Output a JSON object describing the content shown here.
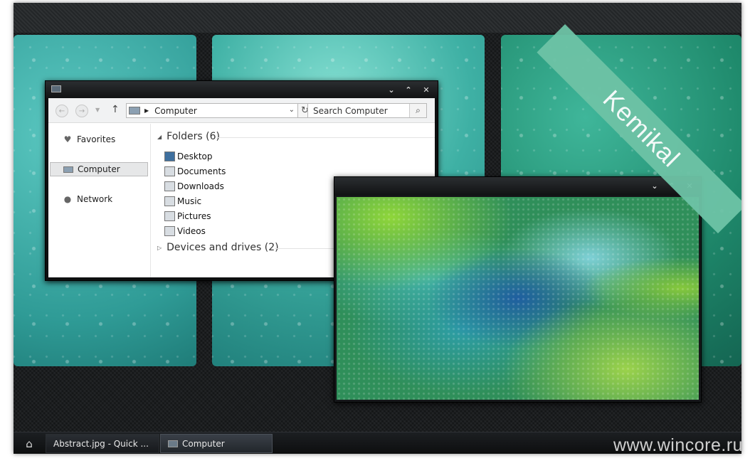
{
  "branding": {
    "ribbon_text": "Kemikal",
    "watermark": "www.wincore.ru"
  },
  "explorer": {
    "caption_buttons": {
      "minimize": "⌄",
      "maximize": "⌃",
      "close": "✕"
    },
    "address": "Computer",
    "search_placeholder": "Search Computer",
    "nav": {
      "favorites": "Favorites",
      "computer": "Computer",
      "network": "Network"
    },
    "groups": [
      {
        "label": "Folders (6)",
        "expanded": true
      },
      {
        "label": "Devices and drives (2)",
        "expanded": false
      }
    ],
    "folders": [
      "Desktop",
      "Documents",
      "Downloads",
      "Music",
      "Pictures",
      "Videos"
    ]
  },
  "viewer": {
    "caption_buttons": {
      "minimize": "⌄",
      "maximize": "⌃",
      "close": "✕"
    }
  },
  "taskbar": {
    "items": [
      {
        "label": "Abstract.jpg - Quick ..."
      },
      {
        "label": "Computer"
      }
    ]
  }
}
